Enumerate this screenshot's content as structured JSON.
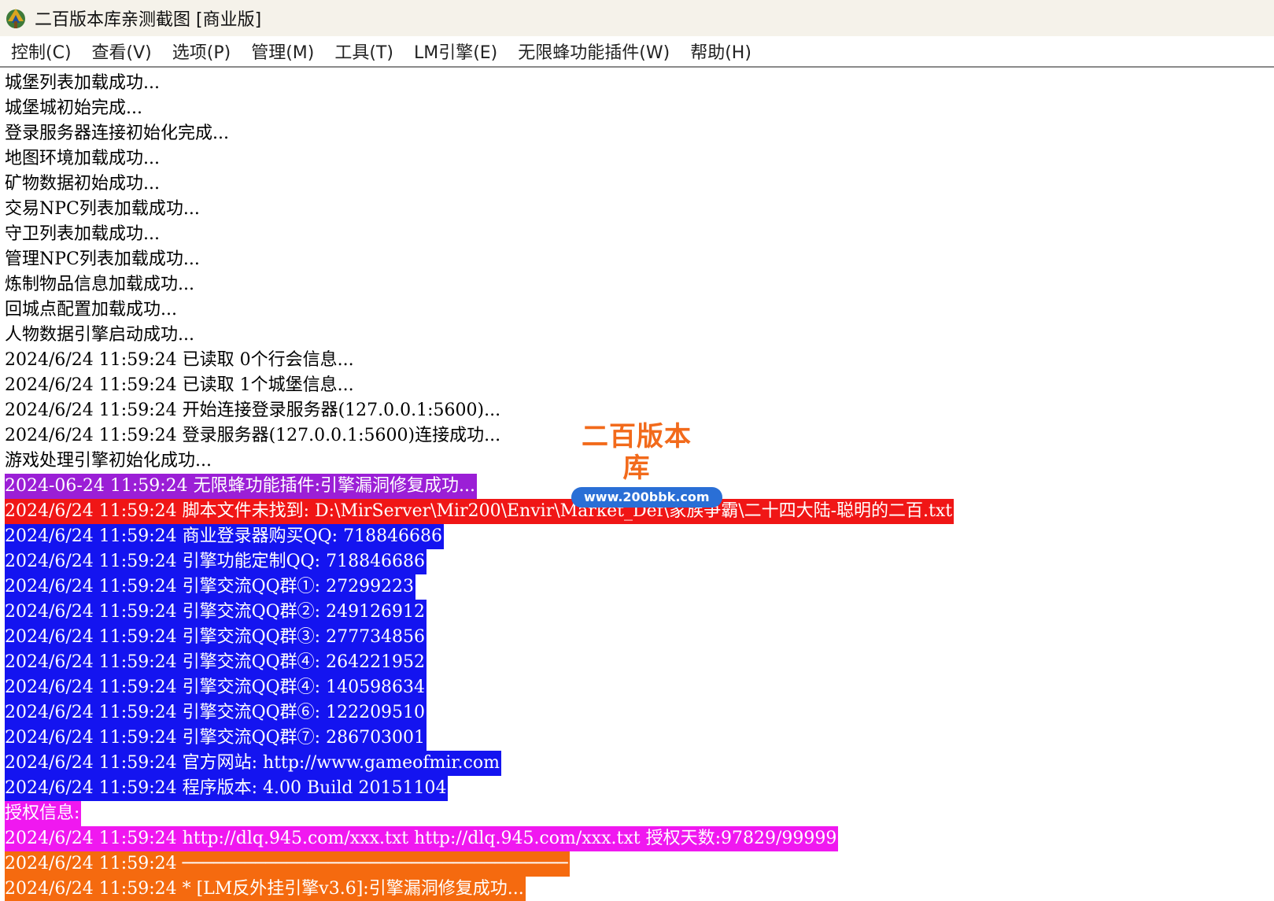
{
  "window": {
    "title": "二百版本库亲测截图 [商业版]"
  },
  "menu": [
    {
      "label": "控制(C)"
    },
    {
      "label": "查看(V)"
    },
    {
      "label": "选项(P)"
    },
    {
      "label": "管理(M)"
    },
    {
      "label": "工具(T)"
    },
    {
      "label": "LM引擎(E)"
    },
    {
      "label": "无限蜂功能插件(W)"
    },
    {
      "label": "帮助(H)"
    }
  ],
  "watermark": {
    "title": "二百版本库",
    "url": "www.200bbk.com"
  },
  "log": [
    {
      "text": "城堡列表加载成功...",
      "bg": "",
      "fg": "#000000"
    },
    {
      "text": "城堡城初始完成...",
      "bg": "",
      "fg": "#000000"
    },
    {
      "text": "登录服务器连接初始化完成...",
      "bg": "",
      "fg": "#000000"
    },
    {
      "text": "地图环境加载成功...",
      "bg": "",
      "fg": "#000000"
    },
    {
      "text": "矿物数据初始成功...",
      "bg": "",
      "fg": "#000000"
    },
    {
      "text": "交易NPC列表加载成功...",
      "bg": "",
      "fg": "#000000"
    },
    {
      "text": "守卫列表加载成功...",
      "bg": "",
      "fg": "#000000"
    },
    {
      "text": "管理NPC列表加载成功...",
      "bg": "",
      "fg": "#000000"
    },
    {
      "text": "炼制物品信息加载成功...",
      "bg": "",
      "fg": "#000000"
    },
    {
      "text": "回城点配置加载成功...",
      "bg": "",
      "fg": "#000000"
    },
    {
      "text": "人物数据引擎启动成功...",
      "bg": "",
      "fg": "#000000"
    },
    {
      "text": "2024/6/24 11:59:24 已读取 0个行会信息...",
      "bg": "",
      "fg": "#000000"
    },
    {
      "text": "2024/6/24 11:59:24 已读取 1个城堡信息...",
      "bg": "",
      "fg": "#000000"
    },
    {
      "text": "2024/6/24 11:59:24 开始连接登录服务器(127.0.0.1:5600)...",
      "bg": "",
      "fg": "#000000"
    },
    {
      "text": "2024/6/24 11:59:24 登录服务器(127.0.0.1:5600)连接成功...",
      "bg": "",
      "fg": "#000000"
    },
    {
      "text": "游戏处理引擎初始化成功...",
      "bg": "",
      "fg": "#000000"
    },
    {
      "text": "2024-06-24 11:59:24 无限蜂功能插件:引擎漏洞修复成功...",
      "bg": "#9b1fd6",
      "fg": "#ffffff"
    },
    {
      "text": "2024/6/24 11:59:24 脚本文件未找到: D:\\MirServer\\Mir200\\Envir\\Market_Def\\家族争霸\\二十四大陆-聪明的二百.txt",
      "bg": "#f01616",
      "fg": "#ffffff"
    },
    {
      "text": "2024/6/24 11:59:24 商业登录器购买QQ: 718846686",
      "bg": "#1414f0",
      "fg": "#ffffff"
    },
    {
      "text": "2024/6/24 11:59:24 引擎功能定制QQ: 718846686",
      "bg": "#1414f0",
      "fg": "#ffffff"
    },
    {
      "text": "2024/6/24 11:59:24 引擎交流QQ群①: 27299223",
      "bg": "#1414f0",
      "fg": "#ffffff"
    },
    {
      "text": "2024/6/24 11:59:24 引擎交流QQ群②: 249126912",
      "bg": "#1414f0",
      "fg": "#ffffff"
    },
    {
      "text": "2024/6/24 11:59:24 引擎交流QQ群③: 277734856",
      "bg": "#1414f0",
      "fg": "#ffffff"
    },
    {
      "text": "2024/6/24 11:59:24 引擎交流QQ群④: 264221952",
      "bg": "#1414f0",
      "fg": "#ffffff"
    },
    {
      "text": "2024/6/24 11:59:24 引擎交流QQ群④: 140598634",
      "bg": "#1414f0",
      "fg": "#ffffff"
    },
    {
      "text": "2024/6/24 11:59:24 引擎交流QQ群⑥: 122209510",
      "bg": "#1414f0",
      "fg": "#ffffff"
    },
    {
      "text": "2024/6/24 11:59:24 引擎交流QQ群⑦: 286703001",
      "bg": "#1414f0",
      "fg": "#ffffff"
    },
    {
      "text": "2024/6/24 11:59:24 官方网站: http://www.gameofmir.com",
      "bg": "#1414f0",
      "fg": "#ffffff"
    },
    {
      "text": "2024/6/24 11:59:24 程序版本: 4.00 Build 20151104",
      "bg": "#1414f0",
      "fg": "#ffffff"
    },
    {
      "text": "授权信息:",
      "bg": "#f018f0",
      "fg": "#ffffff"
    },
    {
      "text": "2024/6/24 11:59:24 http://dlq.945.com/xxx.txt http://dlq.945.com/xxx.txt 授权天数:97829/99999",
      "bg": "#f018f0",
      "fg": "#ffffff"
    },
    {
      "text": "2024/6/24 11:59:24 ─────────────────────────────────────",
      "bg": "#f56a0f",
      "fg": "#ffffff"
    },
    {
      "text": "2024/6/24 11:59:24 * [LM反外挂引擎v3.6]:引擎漏洞修复成功...",
      "bg": "#f56a0f",
      "fg": "#ffffff"
    }
  ]
}
